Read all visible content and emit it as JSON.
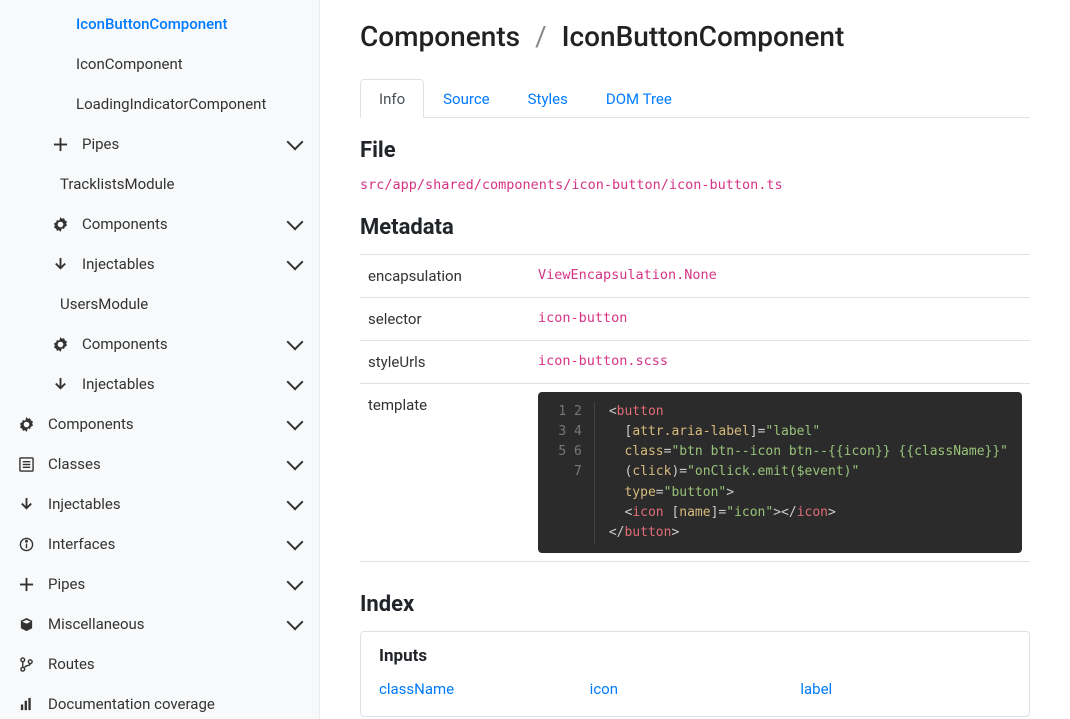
{
  "sidebar": {
    "items": [
      {
        "level": 3,
        "label": "IconButtonComponent",
        "icon": null,
        "expandable": false,
        "active": true
      },
      {
        "level": 3,
        "label": "IconComponent",
        "icon": null,
        "expandable": false
      },
      {
        "level": 3,
        "label": "LoadingIndicatorComponent",
        "icon": null,
        "expandable": false
      },
      {
        "level": 2,
        "label": "Pipes",
        "icon": "plus-icon",
        "expandable": true
      },
      {
        "level": 1,
        "label": "TracklistsModule",
        "icon": null,
        "expandable": false,
        "module": true
      },
      {
        "level": 2,
        "label": "Components",
        "icon": "gear-icon",
        "expandable": true
      },
      {
        "level": 2,
        "label": "Injectables",
        "icon": "arrow-down-icon",
        "expandable": true
      },
      {
        "level": 1,
        "label": "UsersModule",
        "icon": null,
        "expandable": false,
        "module": true
      },
      {
        "level": 2,
        "label": "Components",
        "icon": "gear-icon",
        "expandable": true
      },
      {
        "level": 2,
        "label": "Injectables",
        "icon": "arrow-down-icon",
        "expandable": true
      },
      {
        "level": 0,
        "label": "Components",
        "icon": "gear-icon",
        "expandable": true
      },
      {
        "level": 0,
        "label": "Classes",
        "icon": "list-icon",
        "expandable": true
      },
      {
        "level": 0,
        "label": "Injectables",
        "icon": "arrow-down-icon",
        "expandable": true
      },
      {
        "level": 0,
        "label": "Interfaces",
        "icon": "info-icon",
        "expandable": true
      },
      {
        "level": 0,
        "label": "Pipes",
        "icon": "plus-icon",
        "expandable": true
      },
      {
        "level": 0,
        "label": "Miscellaneous",
        "icon": "cube-icon",
        "expandable": true
      },
      {
        "level": 0,
        "label": "Routes",
        "icon": "branch-icon",
        "expandable": false
      },
      {
        "level": 0,
        "label": "Documentation coverage",
        "icon": "bars-icon",
        "expandable": false
      }
    ]
  },
  "breadcrumb": {
    "parent": "Components",
    "current": "IconButtonComponent"
  },
  "tabs": [
    "Info",
    "Source",
    "Styles",
    "DOM Tree"
  ],
  "activeTab": "Info",
  "sections": {
    "file": "File",
    "metadata": "Metadata",
    "index": "Index",
    "inputs": "Inputs"
  },
  "filePath": "src/app/shared/components/icon-button/icon-button.ts",
  "metadata": [
    {
      "key": "encapsulation",
      "value": "ViewEncapsulation.None"
    },
    {
      "key": "selector",
      "value": "icon-button"
    },
    {
      "key": "styleUrls",
      "value": "icon-button.scss"
    }
  ],
  "templateLabel": "template",
  "templateCode": {
    "lineNumbers": [
      "1",
      "2",
      "3",
      "4",
      "5",
      "6",
      "7"
    ],
    "lines": [
      [
        {
          "t": "pun",
          "v": "<"
        },
        {
          "t": "tag",
          "v": "button"
        }
      ],
      [
        {
          "t": "pun",
          "v": "  ["
        },
        {
          "t": "attr",
          "v": "attr.aria-label"
        },
        {
          "t": "pun",
          "v": "]="
        },
        {
          "t": "str",
          "v": "\"label\""
        }
      ],
      [
        {
          "t": "pun",
          "v": "  "
        },
        {
          "t": "attr",
          "v": "class"
        },
        {
          "t": "pun",
          "v": "="
        },
        {
          "t": "str",
          "v": "\"btn btn--icon btn--{{icon}} {{className}}\""
        }
      ],
      [
        {
          "t": "pun",
          "v": "  ("
        },
        {
          "t": "attr",
          "v": "click"
        },
        {
          "t": "pun",
          "v": ")="
        },
        {
          "t": "str",
          "v": "\"onClick.emit($event)\""
        }
      ],
      [
        {
          "t": "pun",
          "v": "  "
        },
        {
          "t": "attr",
          "v": "type"
        },
        {
          "t": "pun",
          "v": "="
        },
        {
          "t": "str",
          "v": "\"button\""
        },
        {
          "t": "pun",
          "v": ">"
        }
      ],
      [
        {
          "t": "pun",
          "v": "  <"
        },
        {
          "t": "tag",
          "v": "icon"
        },
        {
          "t": "pun",
          "v": " ["
        },
        {
          "t": "attr",
          "v": "name"
        },
        {
          "t": "pun",
          "v": "]="
        },
        {
          "t": "str",
          "v": "\"icon\""
        },
        {
          "t": "pun",
          "v": "></"
        },
        {
          "t": "tag",
          "v": "icon"
        },
        {
          "t": "pun",
          "v": ">"
        }
      ],
      [
        {
          "t": "pun",
          "v": "</"
        },
        {
          "t": "tag",
          "v": "button"
        },
        {
          "t": "pun",
          "v": ">"
        }
      ]
    ]
  },
  "inputs": [
    "className",
    "icon",
    "label"
  ]
}
